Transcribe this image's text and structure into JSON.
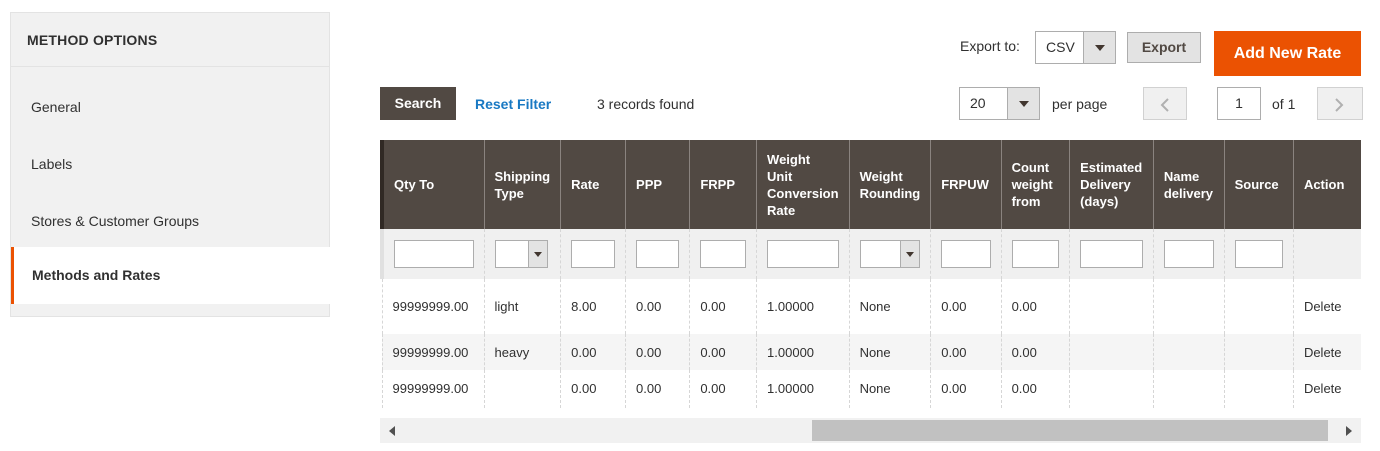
{
  "sidebar": {
    "title": "METHOD OPTIONS",
    "items": [
      {
        "label": "General"
      },
      {
        "label": "Labels"
      },
      {
        "label": "Stores & Customer Groups"
      },
      {
        "label": "Methods and Rates",
        "active": true
      }
    ]
  },
  "toolbar": {
    "export_label": "Export to:",
    "export_format": "CSV",
    "export_button": "Export",
    "add_button": "Add New Rate",
    "search_button": "Search",
    "reset_filter": "Reset Filter",
    "records_found": "3 records found",
    "per_page_value": "20",
    "per_page_label": "per page",
    "current_page": "1",
    "page_of": "of 1"
  },
  "grid": {
    "columns": [
      "Qty To",
      "Shipping Type",
      "Rate",
      "PPP",
      "FRPP",
      "Weight Unit Conversion Rate",
      "Weight Rounding",
      "FRPUW",
      "Count weight from",
      "Estimated Delivery (days)",
      "Name delivery",
      "Source",
      "Action"
    ],
    "rows": [
      [
        "99999999.00",
        "light",
        "8.00",
        "0.00",
        "0.00",
        "1.00000",
        "None",
        "0.00",
        "0.00",
        "",
        "",
        "",
        "Delete"
      ],
      [
        "99999999.00",
        "heavy",
        "0.00",
        "0.00",
        "0.00",
        "1.00000",
        "None",
        "0.00",
        "0.00",
        "",
        "",
        "",
        "Delete"
      ],
      [
        "99999999.00",
        "",
        "0.00",
        "0.00",
        "0.00",
        "1.00000",
        "None",
        "0.00",
        "0.00",
        "",
        "",
        "",
        "Delete"
      ]
    ]
  },
  "colors": {
    "accent": "#eb5202",
    "header_bg": "#514943",
    "link": "#1979c3"
  }
}
